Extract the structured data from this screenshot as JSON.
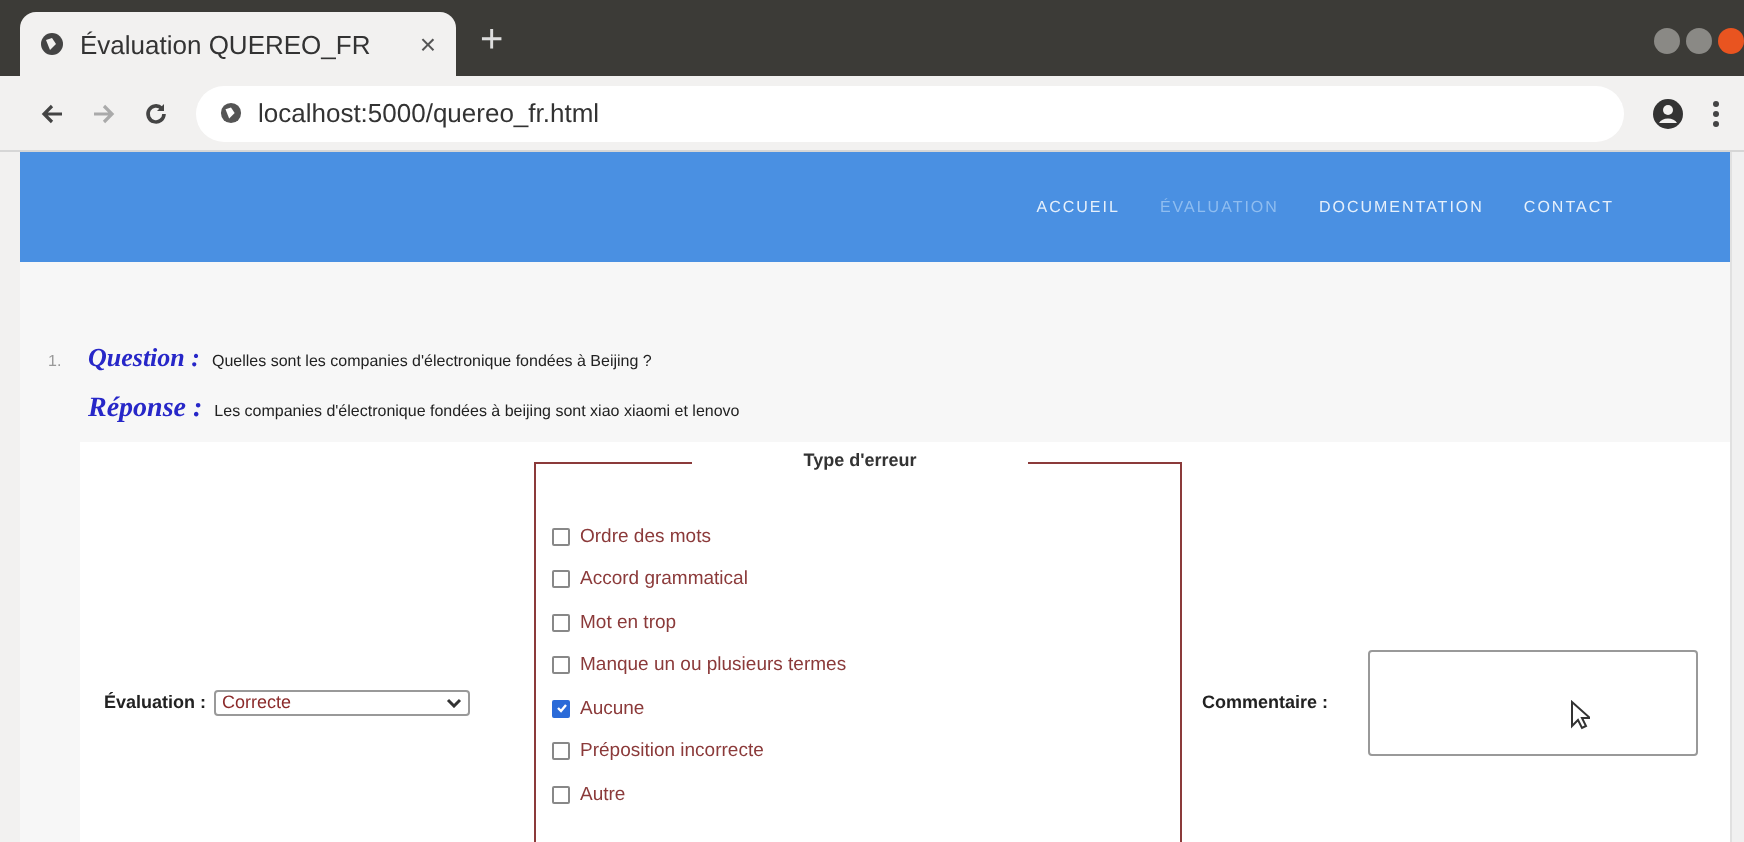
{
  "browser": {
    "tab_title": "Évaluation QUEREO_FR",
    "tab_close": "×",
    "new_tab": "+",
    "url": "localhost:5000/quereo_fr.html"
  },
  "nav": [
    {
      "label": "ACCUEIL",
      "selected": false
    },
    {
      "label": "ÉVALUATION",
      "selected": true
    },
    {
      "label": "DOCUMENTATION",
      "selected": false
    },
    {
      "label": "CONTACT",
      "selected": false
    }
  ],
  "item": {
    "number": "1.",
    "question_label": "Question :",
    "question": "Quelles sont les companies d'électronique fondées à Beijing ?",
    "answer_label": "Réponse :",
    "answer": "Les companies d'électronique fondées à beijing sont xiao xiaomi et lenovo"
  },
  "evaluation": {
    "label": "Évaluation :",
    "value": "Correcte"
  },
  "error_type": {
    "legend": "Type d'erreur",
    "options": [
      {
        "label": "Ordre des mots",
        "checked": false
      },
      {
        "label": "Accord grammatical",
        "checked": false
      },
      {
        "label": "Mot en trop",
        "checked": false
      },
      {
        "label": "Manque un ou plusieurs termes",
        "checked": false
      },
      {
        "label": "Aucune",
        "checked": true
      },
      {
        "label": "Préposition incorrecte",
        "checked": false
      },
      {
        "label": "Autre",
        "checked": false
      }
    ]
  },
  "comment": {
    "label": "Commentaire :"
  }
}
